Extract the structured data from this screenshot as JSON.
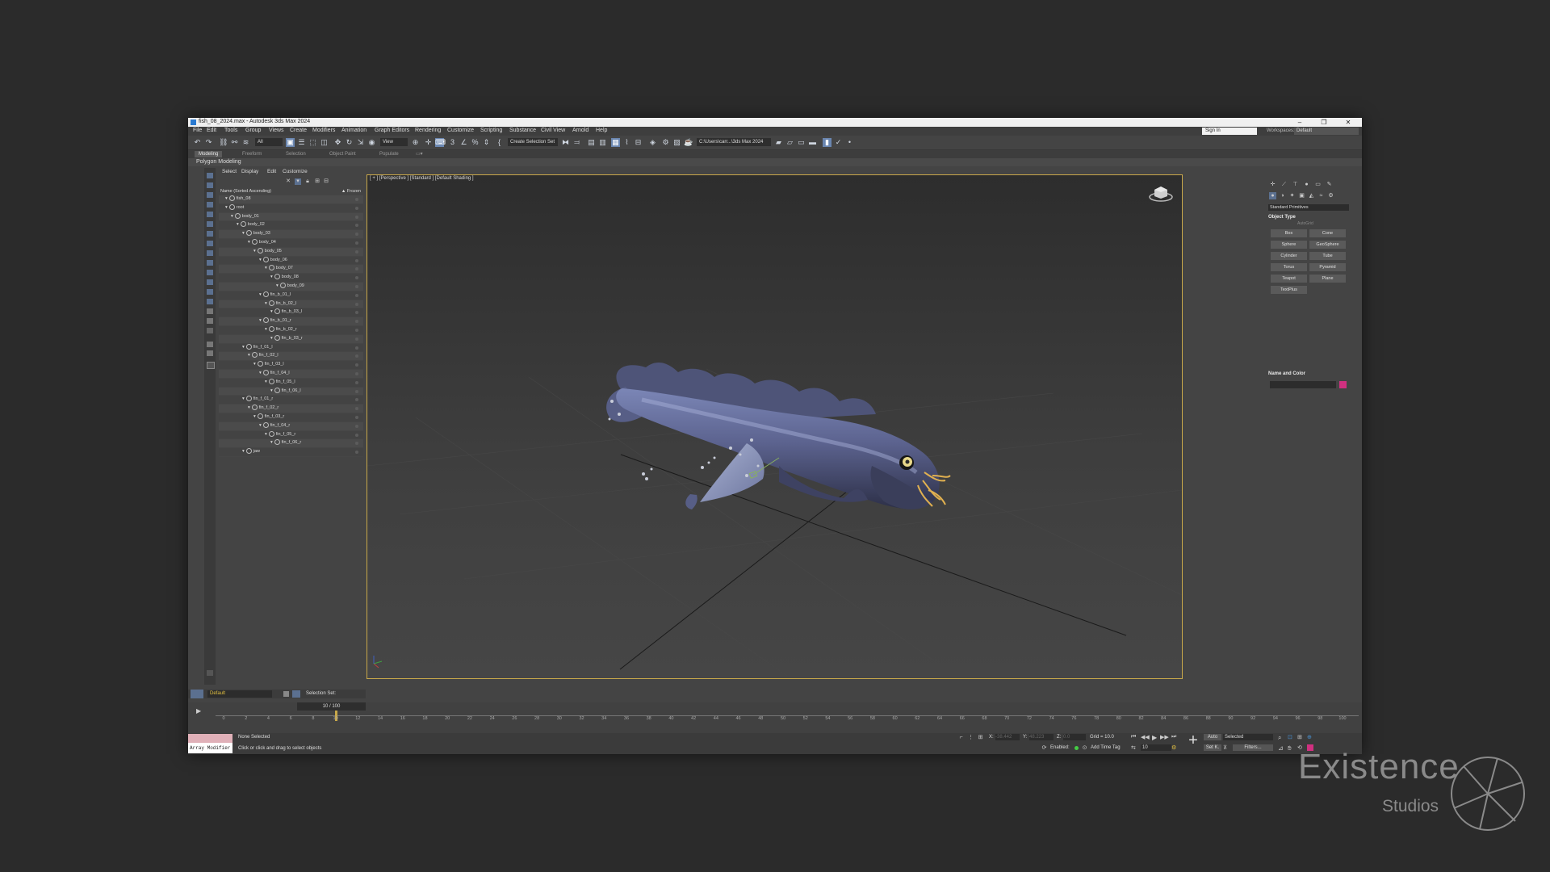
{
  "window": {
    "title": "fish_08_2024.max - Autodesk 3ds Max 2024",
    "controls": [
      "–",
      "❐",
      "✕"
    ]
  },
  "menu": [
    "File",
    "Edit",
    "Tools",
    "Group",
    "Views",
    "Create",
    "Modifiers",
    "Animation",
    "Graph Editors",
    "Rendering",
    "Customize",
    "Scripting",
    "Substance",
    "Civil View",
    "Arnold",
    "Help"
  ],
  "account": {
    "sign_in": "Sign In",
    "workspaces_label": "Workspaces:",
    "workspace": "Default"
  },
  "toolbar": {
    "filter": "All",
    "ref_coord": "View",
    "selection_set": "Create Selection Set",
    "project_path": "C:\\Users\\carr...\\3ds Max 2024"
  },
  "ribbon": {
    "tabs": [
      "Modeling",
      "Freeform",
      "Selection",
      "Object Paint",
      "Populate"
    ],
    "active_tab": "Modeling",
    "panel": "Polygon Modeling"
  },
  "scene_explorer": {
    "tabs": [
      "Select",
      "Display",
      "Edit",
      "Customize"
    ],
    "column_header": "Name (Sorted Ascending)",
    "frozen_header": "▲ Frozen",
    "items": [
      {
        "name": "fish_08",
        "depth": 0
      },
      {
        "name": "root",
        "depth": 0
      },
      {
        "name": "body_01",
        "depth": 1
      },
      {
        "name": "body_02",
        "depth": 2
      },
      {
        "name": "body_03",
        "depth": 3
      },
      {
        "name": "body_04",
        "depth": 4
      },
      {
        "name": "body_05",
        "depth": 5
      },
      {
        "name": "body_06",
        "depth": 6
      },
      {
        "name": "body_07",
        "depth": 7
      },
      {
        "name": "body_08",
        "depth": 8
      },
      {
        "name": "body_09",
        "depth": 9
      },
      {
        "name": "fin_b_01_l",
        "depth": 6
      },
      {
        "name": "fin_b_02_l",
        "depth": 7
      },
      {
        "name": "fin_b_03_l",
        "depth": 8
      },
      {
        "name": "fin_b_01_r",
        "depth": 6
      },
      {
        "name": "fin_b_02_r",
        "depth": 7
      },
      {
        "name": "fin_b_03_r",
        "depth": 8
      },
      {
        "name": "fin_f_01_l",
        "depth": 3
      },
      {
        "name": "fin_f_02_l",
        "depth": 4
      },
      {
        "name": "fin_f_03_l",
        "depth": 5
      },
      {
        "name": "fin_f_04_l",
        "depth": 6
      },
      {
        "name": "fin_f_05_l",
        "depth": 7
      },
      {
        "name": "fin_f_06_l",
        "depth": 8
      },
      {
        "name": "fin_f_01_r",
        "depth": 3
      },
      {
        "name": "fin_f_02_r",
        "depth": 4
      },
      {
        "name": "fin_f_03_r",
        "depth": 5
      },
      {
        "name": "fin_f_04_r",
        "depth": 6
      },
      {
        "name": "fin_f_05_r",
        "depth": 7
      },
      {
        "name": "fin_f_06_r",
        "depth": 8
      },
      {
        "name": "jaw",
        "depth": 3
      }
    ],
    "layer": "Default",
    "selection_set_label": "Selection Set:"
  },
  "viewport": {
    "label": "[ + ] [Perspective ] [Standard ] [Default Shading ]"
  },
  "command_panel": {
    "category": "Standard Primitives",
    "object_type_title": "Object Type",
    "autogrid": "AutoGrid",
    "primitives": [
      "Box",
      "Cone",
      "Sphere",
      "GeoSphere",
      "Cylinder",
      "Tube",
      "Torus",
      "Pyramid",
      "Teapot",
      "Plane",
      "TextPlus"
    ],
    "name_color_title": "Name and Color",
    "color": "#d03080"
  },
  "timeline": {
    "frame": "10 / 100",
    "current_frame": 10,
    "ticks": [
      "0",
      "2",
      "4",
      "6",
      "8",
      "10",
      "12",
      "14",
      "16",
      "18",
      "20",
      "22",
      "24",
      "26",
      "28",
      "30",
      "32",
      "34",
      "36",
      "38",
      "40",
      "42",
      "44",
      "46",
      "48",
      "50",
      "52",
      "54",
      "56",
      "58",
      "60",
      "62",
      "64",
      "66",
      "68",
      "70",
      "72",
      "74",
      "76",
      "78",
      "80",
      "82",
      "84",
      "86",
      "88",
      "90",
      "92",
      "94",
      "96",
      "98",
      "100"
    ]
  },
  "status": {
    "maxscript": "Array Modifier",
    "selection": "None Selected",
    "prompt": "Click or click and drag to select objects",
    "x_label": "X:",
    "x_value": "-38.442",
    "y_label": "Y:",
    "y_value": "48.223",
    "z_label": "Z:",
    "z_value": "0.0",
    "grid": "Grid = 10.0",
    "enabled": "Enabled:",
    "add_time_tag": "Add Time Tag",
    "auto": "Auto",
    "set_k": "Set K.",
    "key_mode": "Selected",
    "filters": "Filters...",
    "frame_field": "10"
  },
  "watermark": {
    "name": "Existence",
    "sub": "Studios"
  }
}
